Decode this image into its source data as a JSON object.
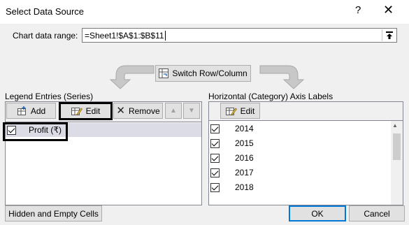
{
  "window": {
    "title": "Select Data Source",
    "help_label": "?",
    "close_label": "✕"
  },
  "range": {
    "label": "Chart data range:",
    "value": "=Sheet1!$A$1:$B$11"
  },
  "switch_button": {
    "label": "Switch Row/Column"
  },
  "legend": {
    "heading": "Legend Entries (Series)",
    "add_label": "Add",
    "edit_label": "Edit",
    "remove_label": "Remove",
    "up_label": "▲",
    "down_label": "▼",
    "items": [
      {
        "label": "Profit (₹)",
        "checked": true
      }
    ]
  },
  "axis": {
    "heading": "Horizontal (Category) Axis Labels",
    "edit_label": "Edit",
    "items": [
      {
        "label": "2014",
        "checked": true
      },
      {
        "label": "2015",
        "checked": true
      },
      {
        "label": "2016",
        "checked": true
      },
      {
        "label": "2017",
        "checked": true
      },
      {
        "label": "2018",
        "checked": true
      }
    ]
  },
  "footer": {
    "hidden_cells_label": "Hidden and Empty Cells",
    "ok_label": "OK",
    "cancel_label": "Cancel"
  },
  "colors": {
    "selected_row": "#dcdce6",
    "button_bg": "#e1e1e1",
    "highlight_border": "#000000"
  }
}
